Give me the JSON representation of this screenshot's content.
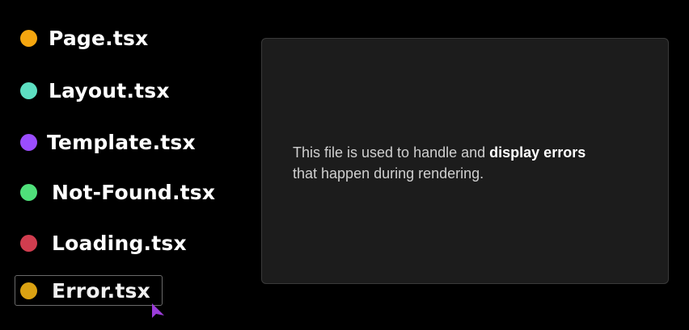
{
  "files": [
    {
      "label": "Page.tsx",
      "color": "#f5a60f"
    },
    {
      "label": "Layout.tsx",
      "color": "#5ddfc2"
    },
    {
      "label": "Template.tsx",
      "color": "#9b4dff"
    },
    {
      "label": "Not-Found.tsx",
      "color": "#4fe07a"
    },
    {
      "label": "Loading.tsx",
      "color": "#d13d4f"
    },
    {
      "label": "Error.tsx",
      "color": "#dba212",
      "selected": true
    }
  ],
  "panel": {
    "text_before": "This file is used to handle and ",
    "text_bold": "display errors",
    "text_after": "that happen during rendering."
  },
  "cursor": {
    "color": "#9b3dd9"
  }
}
